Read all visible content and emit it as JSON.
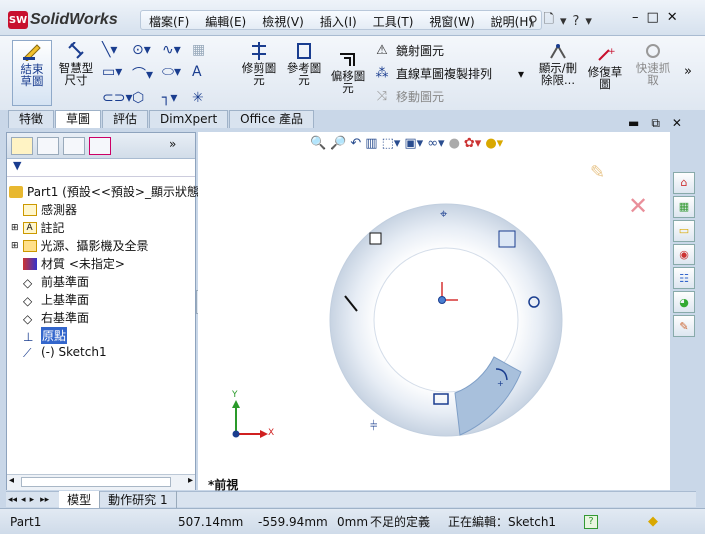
{
  "app": {
    "logo_text": "SolidWorks",
    "logo_badge": "SW"
  },
  "menu": [
    "檔案(F)",
    "編輯(E)",
    "檢視(V)",
    "插入(I)",
    "工具(T)",
    "視窗(W)",
    "說明(H)"
  ],
  "ribbon": {
    "exit_sketch": "結束\n草圖",
    "smart_dim": "智慧型\n尺寸",
    "trim": "修剪圖\n元",
    "convert": "參考圖\n元",
    "offset": "偏移圖\n元",
    "mirror": "鏡射圖元",
    "linear_pattern": "直線草圖複製排列",
    "move": "移動圖元",
    "display_delete": "顯示/刪\n除限...",
    "repair": "修復草\n圖",
    "quick_snap": "快速抓\n取"
  },
  "command_tabs": [
    "特徵",
    "草圖",
    "評估",
    "DimXpert",
    "Office 產品"
  ],
  "active_tab": "草圖",
  "tree": {
    "root": "Part1  (預設<<預設>_顯示狀態",
    "items": [
      "感測器",
      "註記",
      "光源、攝影機及全景",
      "材質 <未指定>",
      "前基準面",
      "上基準面",
      "右基準面",
      "原點",
      "(-) Sketch1"
    ]
  },
  "viewport": {
    "view_label": "*前視",
    "axis_x": "X",
    "axis_y": "Y"
  },
  "bottom_tabs": [
    "模型",
    "動作研究 1"
  ],
  "status": {
    "doc": "Part1",
    "x": "507.14mm",
    "y": "-559.94mm",
    "z": "0mm",
    "state": "不足的定義",
    "editing": "正在編輯：Sketch1"
  }
}
